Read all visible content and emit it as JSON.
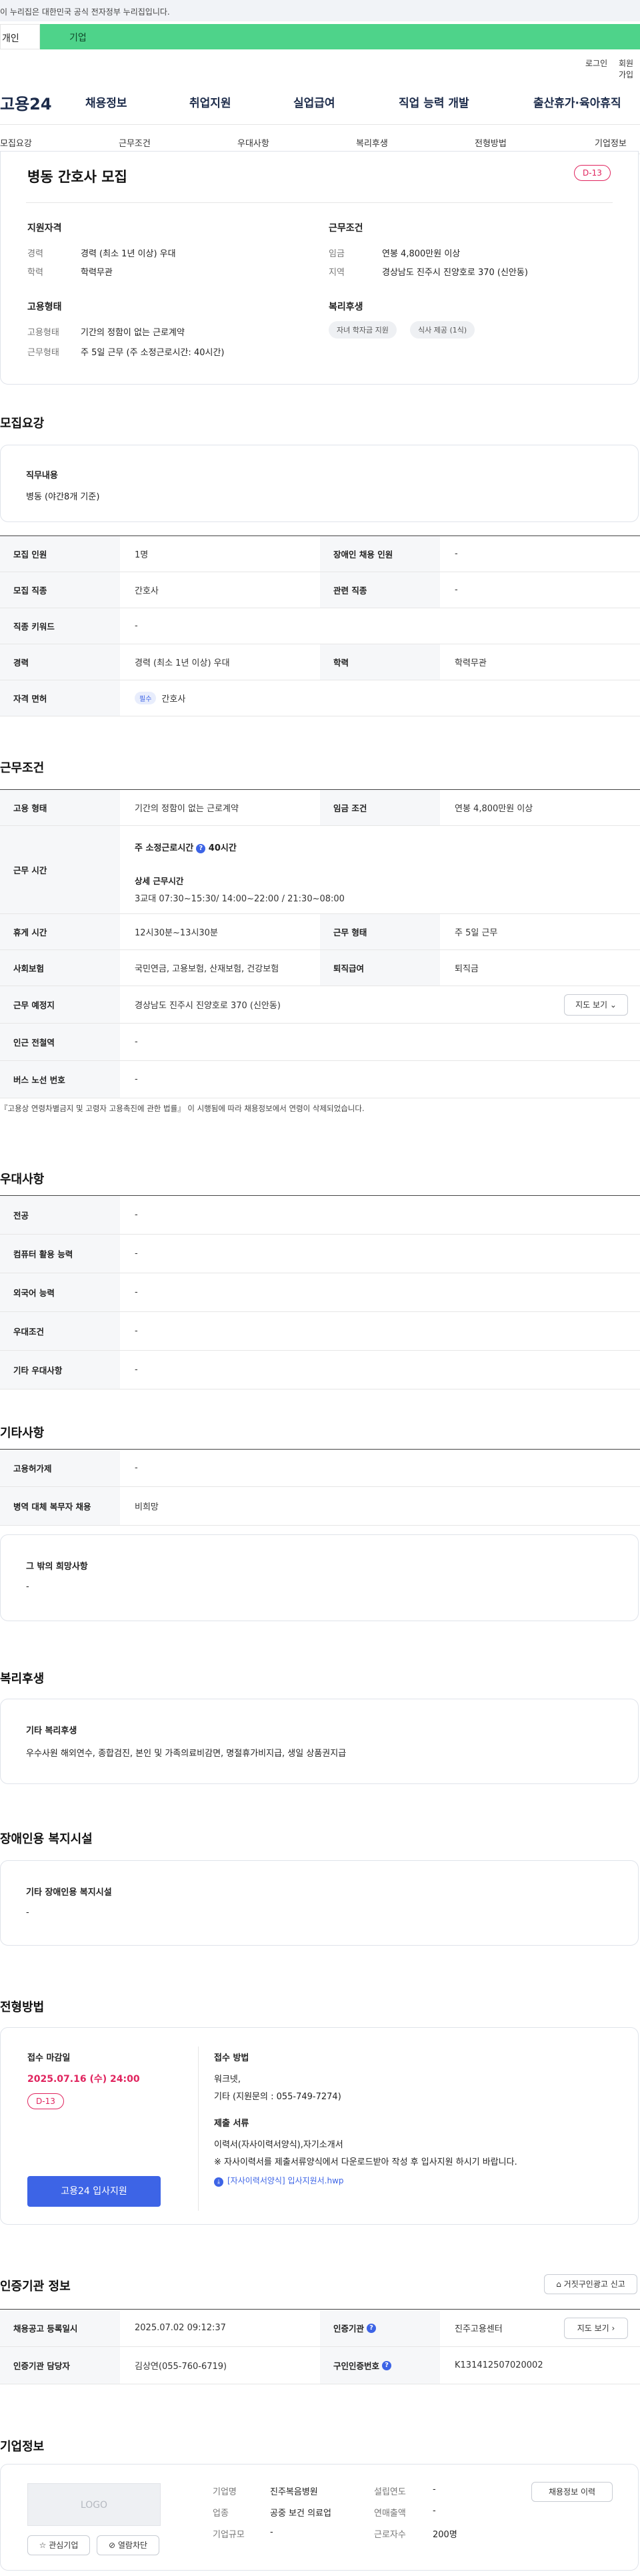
{
  "gov_notice": "이 누리집은 대한민국 공식 전자정부 누리집입니다.",
  "user_tabs": {
    "person": "개인",
    "business": "기업"
  },
  "util": {
    "login": "로그인",
    "signup": "회원가입"
  },
  "logo": "고용24",
  "gnb": [
    "채용정보",
    "취업지원",
    "실업급여",
    "직업 능력 개발",
    "출산휴가·육아휴직"
  ],
  "subnav": [
    "모집요강",
    "근무조건",
    "우대사항",
    "복리후생",
    "전형방법",
    "기업정보"
  ],
  "summary": {
    "title": "병동 간호사 모집",
    "dday": "D-13",
    "qual_title": "지원자격",
    "qual": [
      {
        "k": "경력",
        "v": "경력 (최소 1년 이상) 우대"
      },
      {
        "k": "학력",
        "v": "학력무관"
      }
    ],
    "cond_title": "근무조건",
    "cond": [
      {
        "k": "임금",
        "v": "연봉 4,800만원 이상"
      },
      {
        "k": "지역",
        "v": "경상남도 진주시 진양호로 370 (신안동)"
      }
    ],
    "emp_title": "고용형태",
    "emp": [
      {
        "k": "고용형태",
        "v": "기간의 정함이 없는 근로계약"
      },
      {
        "k": "근무형태",
        "v": "주 5일 근무 (주 소정근로시간: 40시간)"
      }
    ],
    "welfare_title": "복리후생",
    "welfare_chips": [
      "자녀 학자금 지원",
      "식사 제공 (1식)"
    ]
  },
  "recruit": {
    "section": "모집요강",
    "duty_title": "직무내용",
    "duty_text": "병동 (야간8개 기준)",
    "rows": [
      {
        "k1": "모집 인원",
        "v1": "1명",
        "k2": "장애인 채용 인원",
        "v2": "-"
      },
      {
        "k1": "모집 직종",
        "v1": "간호사",
        "k2": "관련 직종",
        "v2": "-"
      },
      {
        "k1": "직종 키워드",
        "v1": "-"
      },
      {
        "k1": "경력",
        "v1": "경력 (최소 1년 이상) 우대",
        "k2": "학력",
        "v2": "학력무관"
      },
      {
        "k1": "자격 면허",
        "v1": "간호사",
        "tag": "필수"
      }
    ]
  },
  "work": {
    "section": "근무조건",
    "emp_type_k": "고용 형태",
    "emp_type_v": "기간의 정함이 없는 근로계약",
    "wage_k": "임금 조건",
    "wage_v": "연봉 4,800만원 이상",
    "hours_k": "근무 시간",
    "hours_week": "주 소정근로시간",
    "hours_week_v": "40시간",
    "hours_detail_label": "상세 근무시간",
    "hours_detail": "3교대  07:30~15:30/ 14:00~22:00 / 21:30~08:00",
    "rest_k": "휴게 시간",
    "rest_v": "12시30분~13시30분",
    "form_k": "근무 형태",
    "form_v": "주 5일 근무",
    "ins_k": "사회보험",
    "ins_v": "국민연금, 고용보험, 산재보험, 건강보험",
    "sev_k": "퇴직급여",
    "sev_v": "퇴직금",
    "place_k": "근무 예정지",
    "place_v": "경상남도 진주시 진양호로 370 (신안동)",
    "map_btn": "지도 보기",
    "subway_k": "인근 전철역",
    "subway_v": "-",
    "bus_k": "버스 노선 번호",
    "bus_v": "-",
    "note": "『고용상 연령차별금지 및 고령자 고용촉진에 관한 법률』 이 시행됨에 따라 채용정보에서 연령이 삭제되었습니다."
  },
  "pref": {
    "section": "우대사항",
    "rows": [
      {
        "k": "전공",
        "v": "-"
      },
      {
        "k": "컴퓨터 활용 능력",
        "v": "-"
      },
      {
        "k": "외국어 능력",
        "v": "-"
      },
      {
        "k": "우대조건",
        "v": "-"
      },
      {
        "k": "기타 우대사항",
        "v": "-"
      }
    ]
  },
  "etc": {
    "section": "기타사항",
    "rows": [
      {
        "k": "고용허가제",
        "v": "-"
      },
      {
        "k": "병역 대체 복무자 채용",
        "v": "비희망"
      }
    ],
    "card_title": "그 밖의 희망사항",
    "card_text": "-"
  },
  "benefit": {
    "section": "복리후생",
    "card_title": "기타 복리후생",
    "card_text": "우수사원 해외연수, 종합검진, 본인 및 가족의료비감면, 명절휴가비지급, 생일 상품권지급"
  },
  "disabled": {
    "section": "장애인용 복지시설",
    "card_title": "기타 장애인용 복지시설",
    "card_text": "-"
  },
  "process": {
    "section": "전형방법",
    "deadline_label": "접수 마감일",
    "deadline": "2025.07.16 (수) 24:00",
    "dday": "D-13",
    "apply_btn": "고용24 입사지원",
    "method_label": "접수 방법",
    "method_lines": [
      "워크넷,",
      "기타 (지원문의 : 055-749-7274)"
    ],
    "docs_label": "제출 서류",
    "docs_lines": [
      "이력서(자사이력서양식),자기소개서",
      "※ 자사이력서를 제출서류양식에서 다운로드받아 작성 후 입사지원 하시기 바랍니다."
    ],
    "file": "[자사이력서양식] 입사지원서.hwp"
  },
  "cert": {
    "section": "인증기관 정보",
    "report_btn": "거짓구인광고 신고",
    "rows": [
      {
        "k1": "채용공고 등록일시",
        "v1": "2025.07.02 09:12:37",
        "k2": "인증기관",
        "v2": "진주고용센터"
      },
      {
        "k1": "인증기관 담당자",
        "v1": "김상연(055-760-6719)",
        "k2": "구인인증번호",
        "v2": "K131412507020002"
      }
    ],
    "map_btn": "지도 보기"
  },
  "company": {
    "section": "기업정보",
    "logo_text": "LOGO",
    "fav_btn": "관심기업",
    "block_btn": "열람차단",
    "history_btn": "채용정보 이력",
    "fields": [
      {
        "k": "기업명",
        "v": "진주복음병원"
      },
      {
        "k": "업종",
        "v": "공중 보건 의료업"
      },
      {
        "k": "기업규모",
        "v": "-"
      },
      {
        "k": "설립연도",
        "v": "-"
      },
      {
        "k": "연매출액",
        "v": "-"
      },
      {
        "k": "근로자수",
        "v": "200명"
      }
    ]
  },
  "colors": {
    "accent": "#3d64e6",
    "dday": "#e0245e",
    "green": "#4ed38a"
  }
}
